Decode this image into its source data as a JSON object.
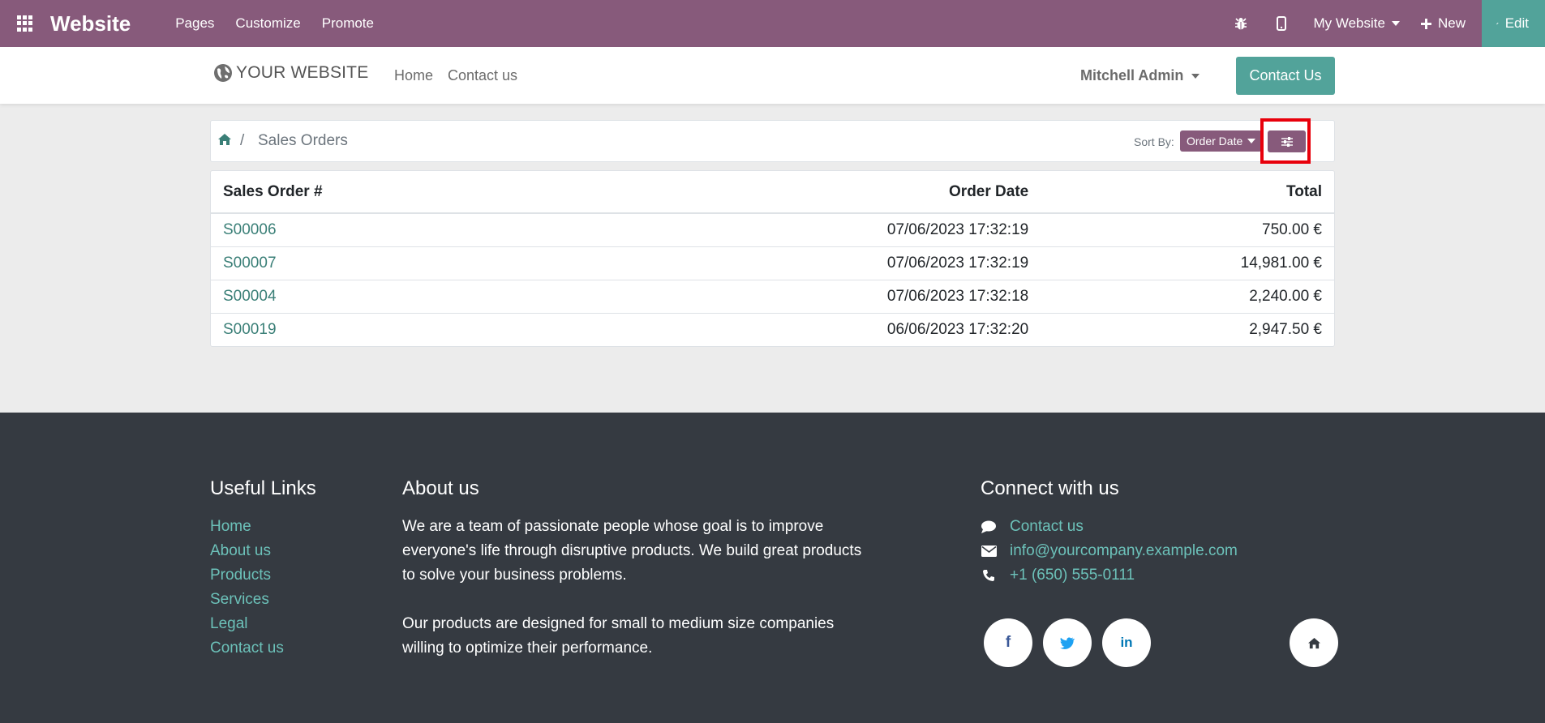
{
  "adminbar": {
    "app_name": "Website",
    "menu": [
      "Pages",
      "Customize",
      "Promote"
    ],
    "website_selector": "My Website",
    "new_label": "New",
    "edit_label": "Edit"
  },
  "header": {
    "logo_text": "YOUR WEBSITE",
    "nav": [
      "Home",
      "Contact us"
    ],
    "user_name": "Mitchell Admin",
    "contact_button": "Contact Us"
  },
  "breadcrumb": {
    "separator": "/",
    "title": "Sales Orders"
  },
  "sort": {
    "label": "Sort By:",
    "selected": "Order Date"
  },
  "orders": {
    "columns": [
      "Sales Order #",
      "Order Date",
      "Total"
    ],
    "rows": [
      {
        "number": "S00006",
        "date": "07/06/2023  17:32:19",
        "total": "750.00 €"
      },
      {
        "number": "S00007",
        "date": "07/06/2023  17:32:19",
        "total": "14,981.00 €"
      },
      {
        "number": "S00004",
        "date": "07/06/2023  17:32:18",
        "total": "2,240.00 €"
      },
      {
        "number": "S00019",
        "date": "06/06/2023  17:32:20",
        "total": "2,947.50 €"
      }
    ]
  },
  "footer": {
    "useful_links_title": "Useful Links",
    "useful_links": [
      "Home",
      "About us",
      "Products",
      "Services",
      "Legal",
      "Contact us"
    ],
    "about_title": "About us",
    "about_p1": "We are a team of passionate people whose goal is to improve everyone's life through disruptive products. We build great products to solve your business problems.",
    "about_p2": "Our products are designed for small to medium size companies willing to optimize their performance.",
    "connect_title": "Connect with us",
    "contact_link": "Contact us",
    "email": "info@yourcompany.example.com",
    "phone": "+1 (650) 555-0111",
    "social_labels": [
      "f",
      "in"
    ]
  },
  "colors": {
    "brand": "#875a7b",
    "accent": "#52a39a",
    "link": "#3a7f77",
    "footer_bg": "#353a41",
    "footer_link": "#6cc1b9",
    "highlight": "#e8000b"
  },
  "icons": [
    "apps-grid-icon",
    "bug-icon",
    "mobile-icon",
    "plus-icon",
    "pencil-icon",
    "globe-icon",
    "home-icon",
    "sliders-icon",
    "comment-icon",
    "envelope-icon",
    "phone-icon",
    "facebook-icon",
    "twitter-icon",
    "linkedin-icon"
  ]
}
